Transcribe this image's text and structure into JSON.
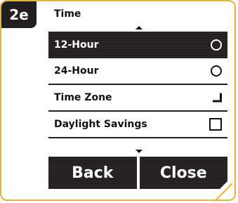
{
  "step_label": "2e",
  "screen": {
    "title": "Time",
    "items": [
      {
        "label": "12-Hour",
        "control": "radio",
        "selected": true
      },
      {
        "label": "24-Hour",
        "control": "radio",
        "selected": false
      },
      {
        "label": "Time Zone",
        "control": "chevron",
        "selected": false
      },
      {
        "label": "Daylight Savings",
        "control": "checkbox",
        "selected": false,
        "checked": false
      }
    ],
    "buttons": {
      "back": "Back",
      "close": "Close"
    }
  },
  "icons": {
    "scroll_up": "triangle-up-icon",
    "scroll_down": "triangle-down-icon",
    "radio": "radio-circle-icon",
    "submenu": "chevron-right-icon",
    "checkbox": "checkbox-icon"
  },
  "colors": {
    "accent": "#e8b33c",
    "dark": "#231f20",
    "background": "#ffffff"
  }
}
